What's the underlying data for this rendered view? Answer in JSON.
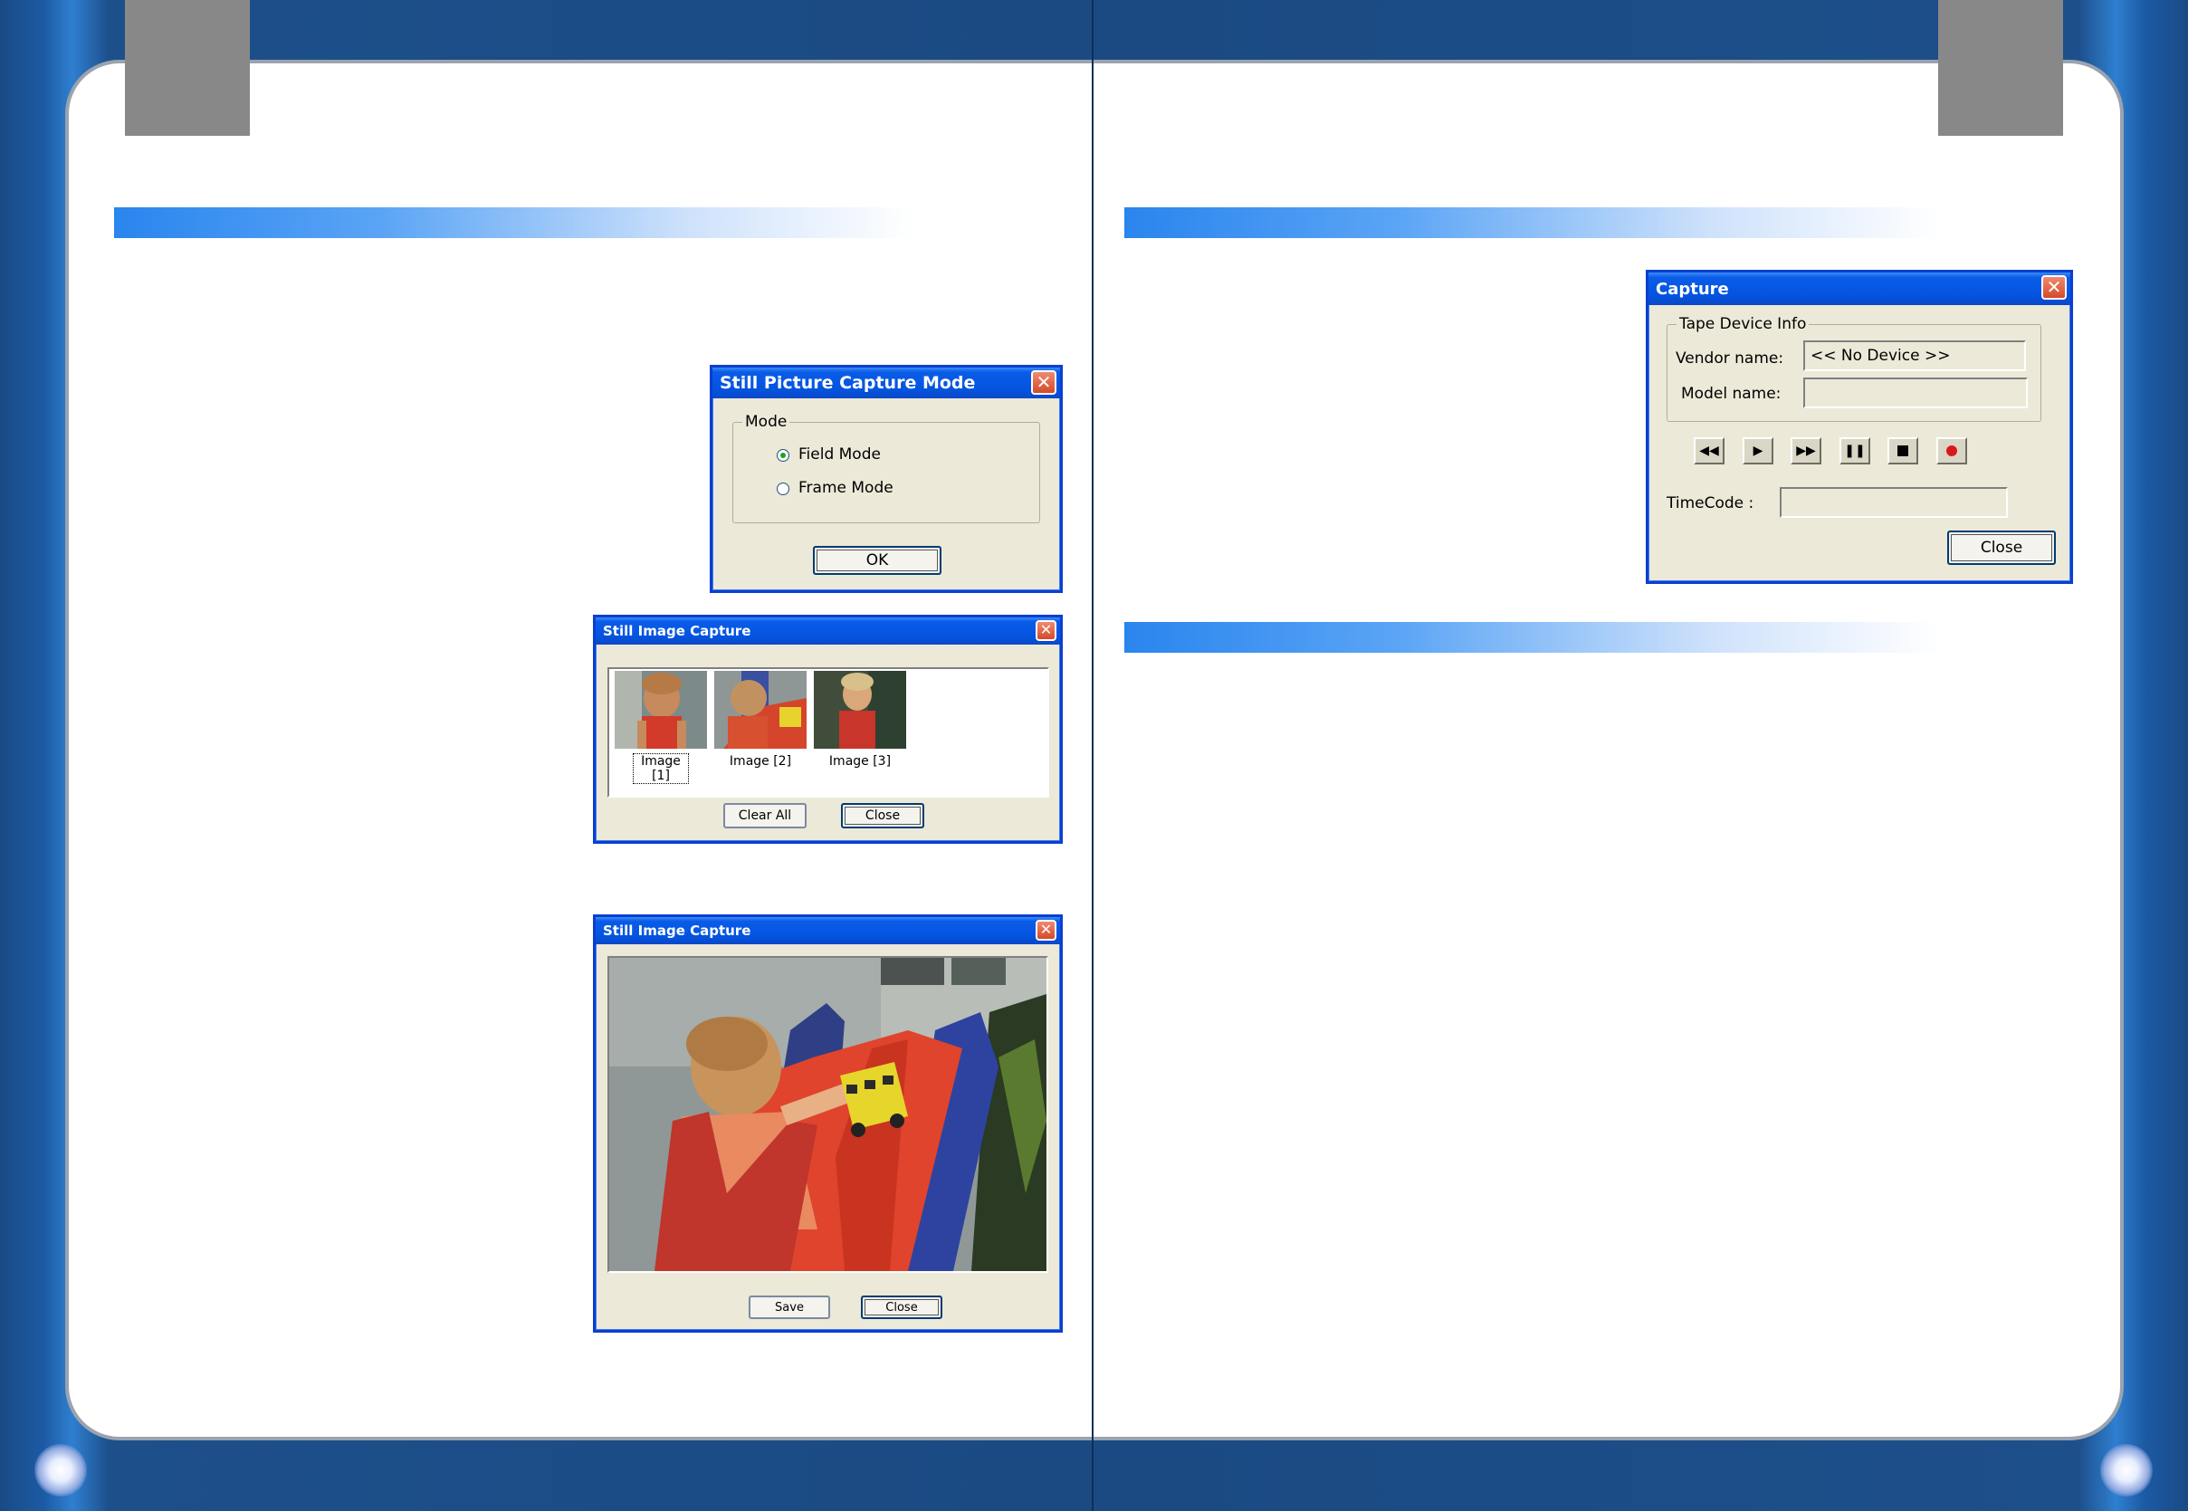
{
  "still_picture_mode_dialog": {
    "title": "Still Picture Capture Mode",
    "group_label": "Mode",
    "options": [
      {
        "label": "Field Mode",
        "selected": true
      },
      {
        "label": "Frame Mode",
        "selected": false
      }
    ],
    "ok_label": "OK"
  },
  "still_image_capture_thumbs": {
    "title": "Still Image Capture",
    "thumbnails": [
      "Image [1]",
      "Image [2]",
      "Image [3]"
    ],
    "clear_all_label": "Clear All",
    "close_label": "Close"
  },
  "still_image_capture_view": {
    "title": "Still Image Capture",
    "save_label": "Save",
    "close_label": "Close"
  },
  "capture_dialog": {
    "title": "Capture",
    "group_label": "Tape Device Info",
    "vendor_label": "Vendor name:",
    "vendor_value": "<< No Device >>",
    "model_label": "Model name:",
    "model_value": "",
    "controls": [
      "rewind-icon",
      "play-icon",
      "fast-forward-icon",
      "pause-icon",
      "stop-icon",
      "record-icon"
    ],
    "timecode_label": "TimeCode :",
    "timecode_value": "",
    "close_label": "Close"
  },
  "colors": {
    "xp_title": "#0454e0",
    "dialog_bg": "#ece9d8",
    "section_bar": "#2a85ee",
    "frame_blue": "#1b4a82"
  }
}
